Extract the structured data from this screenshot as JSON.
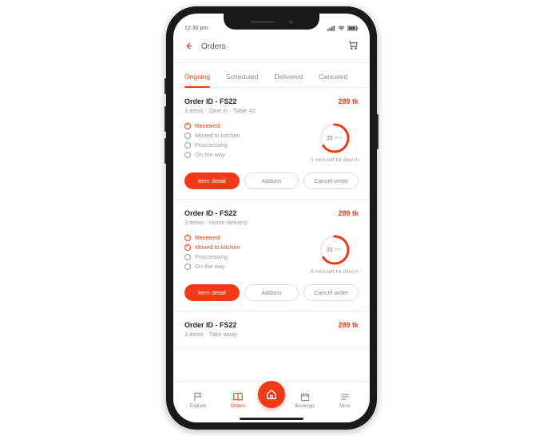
{
  "statusbar": {
    "time": "12:30 pm"
  },
  "header": {
    "title": "Orders"
  },
  "tabs": [
    {
      "label": "Ongoing",
      "active": true
    },
    {
      "label": "Scheduled",
      "active": false
    },
    {
      "label": "Delivered",
      "active": false
    },
    {
      "label": "Canceled",
      "active": false
    }
  ],
  "orders": [
    {
      "id": "Order ID - FS22",
      "price": "289 tk",
      "sub": "3 items · Dine in · Table #2",
      "steps": [
        {
          "label": "Received",
          "active": true
        },
        {
          "label": "Moved to kitchen",
          "active": false
        },
        {
          "label": "Proccessing",
          "active": false
        },
        {
          "label": "On the way",
          "active": false
        }
      ],
      "timer": {
        "value": "21",
        "unit": "mins",
        "sub": "9 mins left for dine in",
        "progress": 0.65
      },
      "actions": {
        "detail": "Item detail",
        "addons": "Addons",
        "cancel": "Cancel order"
      }
    },
    {
      "id": "Order ID - FS22",
      "price": "289 tk",
      "sub": "3 items · Home delivery",
      "steps": [
        {
          "label": "Received",
          "active": true
        },
        {
          "label": "Moved to kitchen",
          "active": true
        },
        {
          "label": "Proccessing",
          "active": false
        },
        {
          "label": "On the way",
          "active": false
        }
      ],
      "timer": {
        "value": "21",
        "unit": "mins",
        "sub": "9 mins left for dine in",
        "progress": 0.65
      },
      "actions": {
        "detail": "Item detail",
        "addons": "Addons",
        "cancel": "Cancel order"
      }
    },
    {
      "id": "Order ID - FS22",
      "price": "289 tk",
      "sub": "3 items · Take away"
    }
  ],
  "bottomnav": {
    "explore": "Explore",
    "orders": "Orders",
    "bookings": "Bookings",
    "more": "More"
  }
}
